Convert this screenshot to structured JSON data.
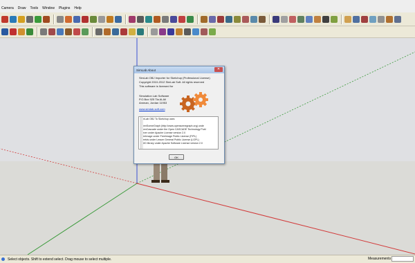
{
  "menu": [
    "Camera",
    "Draw",
    "Tools",
    "Window",
    "Plugins",
    "Help"
  ],
  "dialog": {
    "title": "SimLab About",
    "product": "SimLab OBJ Importer for Sketchup (Professional License)",
    "copyright": "Copyright 2010-2012 SimLab Soft. All rights reserved",
    "licensed_to": "This software is licensed for",
    "company": "Simulation Lab Software",
    "po_box": "P.O.Box 925 Tla Al-Ali",
    "city": "Amman, Jordan 11953",
    "website": "www.simlab-soft.com",
    "license_lines": [
      "SimLab OBJ To Sketchup uses",
      "",
      "OpenSceneGraph (http://www.openscenegraph.org) unde",
      "OpenCascade under the Open CASCADE Technology Publ",
      "server under Apache License version 2.0",
      "FreeImage under FreeImage Public License (FIPL)",
      "Freetds under Lesser General Public License (LGPL)",
      "UUID library under Apache Software License version 2.0"
    ],
    "ok_label": "OK"
  },
  "status": {
    "text": "Select objects. Shift to extend select. Drag mouse to select multiple.",
    "measurements_label": "Measurements"
  },
  "colors": {
    "axis_red": "#d23a3a",
    "axis_green": "#3a9a3a",
    "axis_blue": "#3a4fd2",
    "gear_orange": "#e07a2a"
  }
}
